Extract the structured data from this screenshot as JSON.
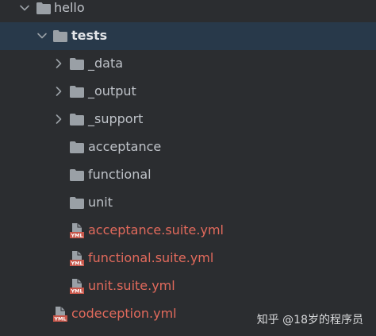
{
  "project_tree": {
    "root": {
      "label": "hello",
      "expanded": true,
      "icon": "folder-icon"
    },
    "tests": {
      "label": "tests",
      "expanded": true,
      "selected": true,
      "icon": "folder-icon"
    },
    "children": [
      {
        "label": "_data",
        "type": "folder",
        "expandable": true
      },
      {
        "label": "_output",
        "type": "folder",
        "expandable": true
      },
      {
        "label": "_support",
        "type": "folder",
        "expandable": true
      },
      {
        "label": "acceptance",
        "type": "folder",
        "expandable": false
      },
      {
        "label": "functional",
        "type": "folder",
        "expandable": false
      },
      {
        "label": "unit",
        "type": "folder",
        "expandable": false
      },
      {
        "label": "acceptance.suite.yml",
        "type": "yml-file"
      },
      {
        "label": "functional.suite.yml",
        "type": "yml-file"
      },
      {
        "label": "unit.suite.yml",
        "type": "yml-file"
      }
    ],
    "root_files": [
      {
        "label": "codeception.yml",
        "type": "yml-file"
      }
    ]
  },
  "watermark": {
    "text": "知乎 @18岁的程序员"
  },
  "colors": {
    "background": "#2b2d30",
    "selection": "#28394a",
    "folder_text": "#bfc3c9",
    "yml_text": "#e26a5c",
    "folder_icon": "#9aa0a6",
    "chevron": "#9aa0a6"
  },
  "icon_labels": {
    "yml_badge": "YML"
  }
}
